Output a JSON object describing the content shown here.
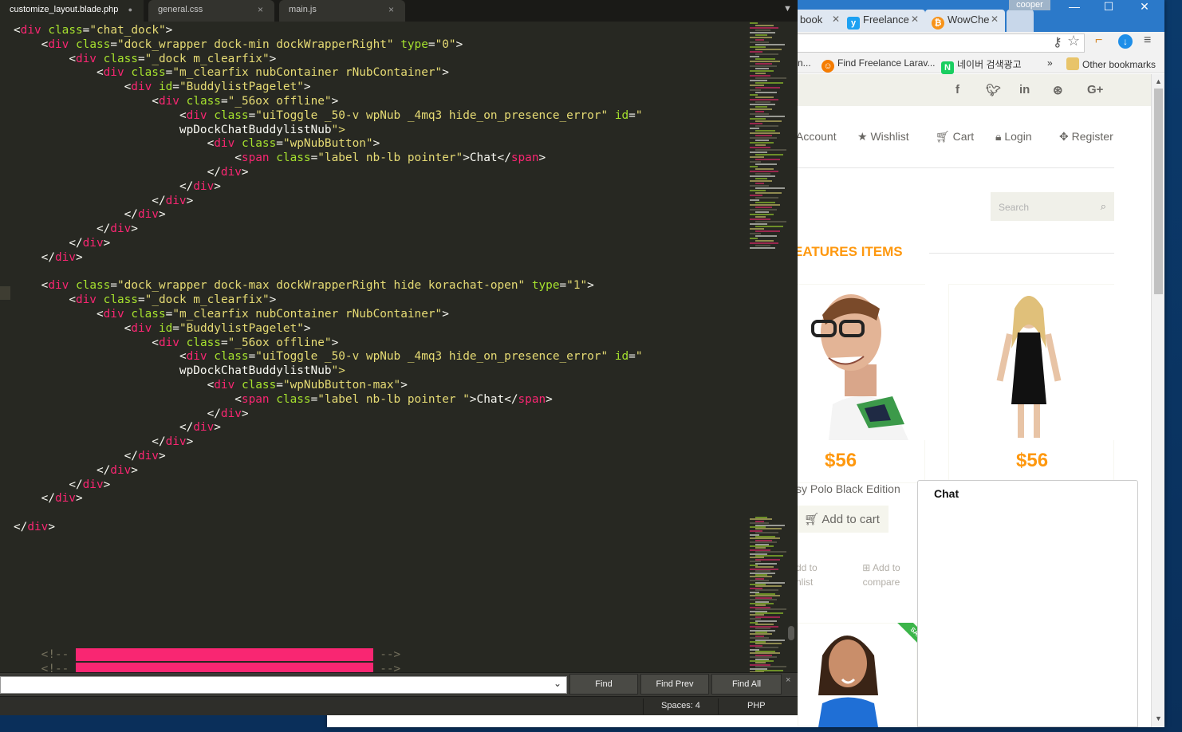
{
  "browser": {
    "tabs": [
      {
        "label": "book",
        "icon": "page-icon"
      },
      {
        "label": "Freelance",
        "icon": "freelancer-logo-icon"
      },
      {
        "label": "WowChe",
        "icon": "bitcoin-icon"
      }
    ],
    "user_badge": "cooper",
    "window_controls": {
      "minimize": "—",
      "maximize": "☐",
      "close": "✕"
    },
    "bookmarks": [
      {
        "label": "n..."
      },
      {
        "label": "Find Freelance Larav...",
        "icon": "smile-icon"
      },
      {
        "label": "네이버 검색광고",
        "icon": "naver-icon"
      },
      {
        "label": "»"
      },
      {
        "label": "Other bookmarks",
        "icon": "folder-icon"
      }
    ],
    "site": {
      "social": [
        "f",
        "t",
        "in",
        "⊛",
        "G+"
      ],
      "nav": [
        "Account",
        "Wishlist",
        "Cart",
        "Login",
        "Register"
      ],
      "search_placeholder": "Search",
      "features_title": "EATURES ITEMS",
      "prices": [
        "$56",
        "$56"
      ],
      "product_name": "sy Polo Black Edition",
      "add_to_cart": "Add to cart",
      "add_to_wishlist": [
        "dd to",
        "hlist"
      ],
      "add_to_compare": [
        "Add to",
        "compare"
      ],
      "sale_label": "SALE",
      "chat_title": "Chat"
    }
  },
  "editor": {
    "tabs": [
      {
        "label": "customize_layout.blade.php",
        "modified": "●"
      },
      {
        "label": "general.css",
        "close": "×"
      },
      {
        "label": "main.js",
        "close": "×"
      }
    ],
    "tab_menu": "▼",
    "find": {
      "find_label": "Find",
      "find_prev_label": "Find Prev",
      "find_all_label": "Find All",
      "close": "×"
    },
    "status": {
      "spaces": "Spaces: 4",
      "syntax": "PHP"
    },
    "code_lines": [
      "<div class=\"chat_dock\">",
      "    <div class=\"dock_wrapper dock-min dockWrapperRight\" type=\"0\">",
      "        <div class=\"_dock m_clearfix\">",
      "            <div class=\"m_clearfix nubContainer rNubContainer\">",
      "                <div id=\"BuddylistPagelet\">",
      "                    <div class=\"_56ox offline\">",
      "                        <div class=\"uiToggle _50-v wpNub _4mq3 hide_on_presence_error\" id=\"",
      "                        wpDockChatBuddylistNub\">",
      "                            <div class=\"wpNubButton\">",
      "                                <span class=\"label nb-lb pointer\">Chat</span>",
      "                            </div>",
      "                        </div>",
      "                    </div>",
      "                </div>",
      "            </div>",
      "        </div>",
      "    </div>",
      "",
      "    <div class=\"dock_wrapper dock-max dockWrapperRight hide korachat-open\" type=\"1\">",
      "        <div class=\"_dock m_clearfix\">",
      "            <div class=\"m_clearfix nubContainer rNubContainer\">",
      "                <div id=\"BuddylistPagelet\">",
      "                    <div class=\"_56ox offline\">",
      "                        <div class=\"uiToggle _50-v wpNub _4mq3 hide_on_presence_error\" id=\"",
      "                        wpDockChatBuddylistNub\">",
      "                            <div class=\"wpNubButton-max\">",
      "                                <span class=\"label nb-lb pointer \">Chat</span>",
      "                            </div>",
      "                        </div>",
      "                    </div>",
      "                </div>",
      "            </div>",
      "        </div>",
      "    </div>",
      "",
      "</div>",
      "",
      "",
      "",
      "",
      "",
      "",
      "",
      "",
      "    <!-- ------------------------------------------- -->",
      "    <!-- ------------------------------------------- -->"
    ]
  },
  "colors": {
    "editor_bg": "#272822",
    "tag": "#f92672",
    "attr": "#a6e22e",
    "string": "#e6db74",
    "accent_orange": "#fe980f"
  }
}
